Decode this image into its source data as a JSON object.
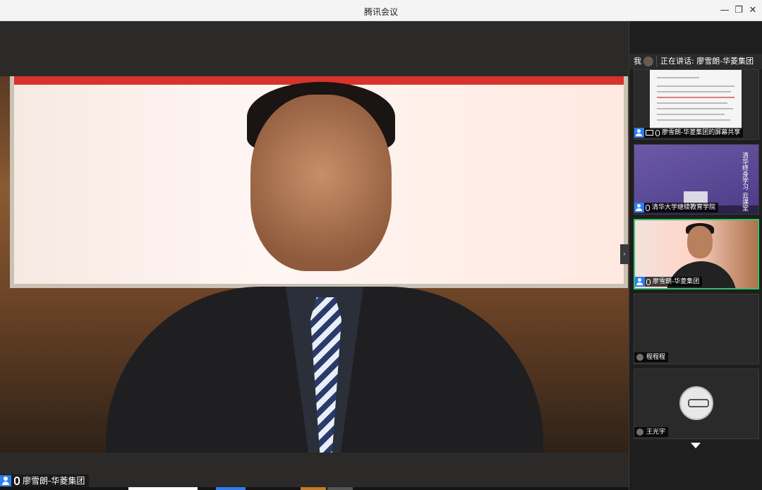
{
  "window": {
    "title": "腾讯会议",
    "minimize_glyph": "—",
    "restore_glyph": "❐",
    "close_glyph": "✕"
  },
  "main_video": {
    "participant_name": "廖雪朗-华菱集团",
    "next_glyph": "›"
  },
  "sidebar": {
    "me_label": "我",
    "speaking_text": "正在讲话: 廖雪朗-华菱集团",
    "tiles": [
      {
        "name": "廖雪朗-华菱集团的屏幕共享",
        "type": "screen-share"
      },
      {
        "name": "清华大学继续教育学院",
        "type": "video",
        "vertical_text": "清华终身学习 云课堂"
      },
      {
        "name": "廖雪朗-华菱集团",
        "type": "video",
        "active": true
      },
      {
        "name": "程程程",
        "type": "camera-off"
      },
      {
        "name": "王光宇",
        "type": "avatar"
      }
    ]
  },
  "colors": {
    "accent_blue": "#2e7df6",
    "active_green": "#35c06a",
    "title_bar_bg": "#f4f4f4"
  }
}
